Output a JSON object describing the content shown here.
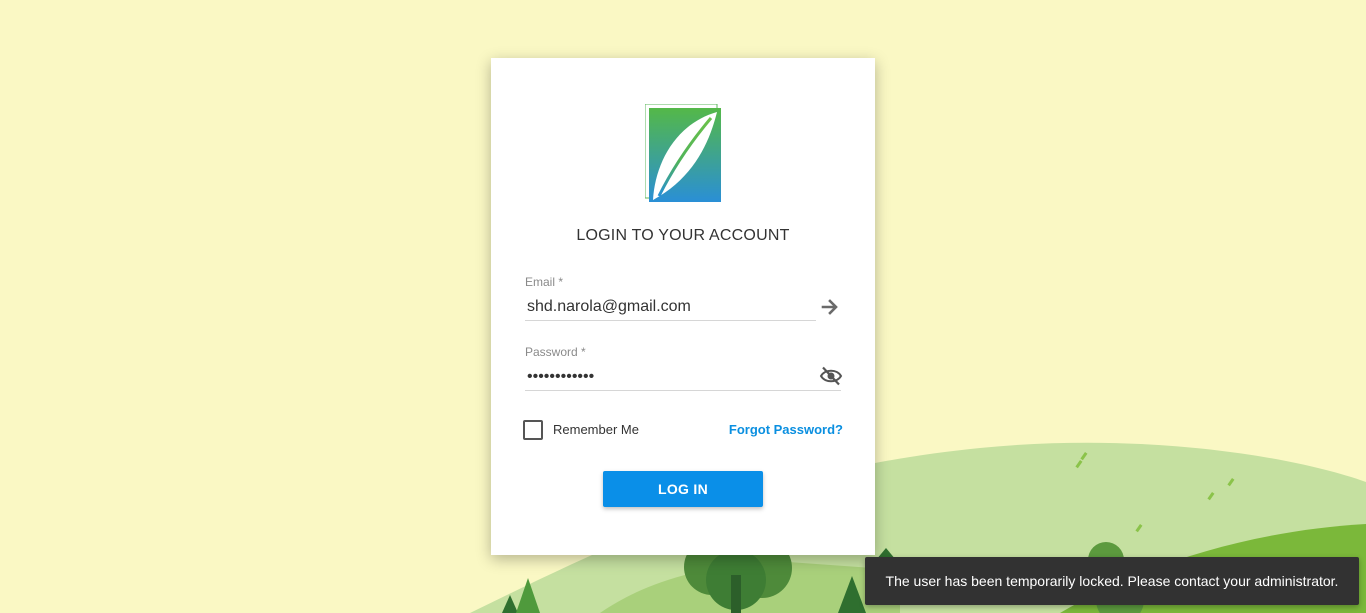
{
  "login": {
    "title": "LOGIN TO YOUR ACCOUNT",
    "email_label": "Email",
    "email_value": "shd.narola@gmail.com",
    "password_label": "Password",
    "password_value": "••••••••••••",
    "required_mark": "*",
    "remember_label": "Remember Me",
    "remember_checked": false,
    "forgot_label": "Forgot Password?",
    "login_button": "LOG IN"
  },
  "toast": {
    "message": "The user has been temporarily locked. Please contact your administrator."
  },
  "icons": {
    "logo": "leaf-logo-icon",
    "submit_email": "arrow-right-icon",
    "toggle_password": "eye-off-icon"
  },
  "colors": {
    "page_background": "#faf8c4",
    "accent": "#0a8fe8",
    "link": "#0a8fe0",
    "toast_background": "#323232",
    "hill_light": "#c5e0a0",
    "hill_dark": "#7bb83a",
    "tree": "#3e7d34"
  }
}
